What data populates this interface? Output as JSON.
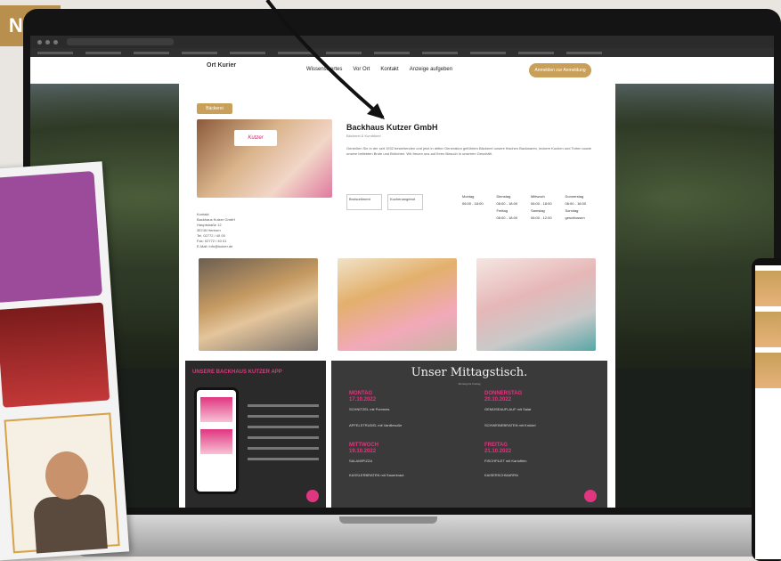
{
  "badge": {
    "text": "NAL"
  },
  "site": {
    "logo": "Ort Kurier",
    "nav": [
      "Wissenswertes",
      "Vor Ort",
      "Kontakt",
      "Anzeige aufgeben"
    ],
    "cta": "Anmelden zur Anmeldung"
  },
  "profile": {
    "tag": "Bäckerei",
    "logo_text": "Kutzer",
    "company": "Backhaus Kutzer GmbH",
    "subtitle": "Bäckerei & Konditorei",
    "description": "Genießen Sie in der seit 1932 bestehenden und jetzt in dritter Generation geführten Bäckerei unsere frischen Backwaren, leckere Kuchen und Torten sowie unsere beliebten Brote und Brötchen. Wir freuen uns auf Ihren Besuch in unserem Geschäft.",
    "info_boxes": [
      "Brotsortiment",
      "Kuchenangebot"
    ],
    "hours": [
      "Montag",
      "Dienstag",
      "Mittwoch",
      "Donnerstag",
      "06:00 - 18:00",
      "06:00 - 18:00",
      "06:00 - 18:00",
      "06:00 - 18:00",
      "",
      "Freitag",
      "Samstag",
      "Sonntag",
      "",
      "06:00 - 18:00",
      "06:00 - 12:00",
      "geschlossen"
    ],
    "contact": [
      "Kontakt",
      "Backhaus Kutzer GmbH",
      "Hauptstraße 12",
      "35745 Herborn",
      "Tel. 02772 / 40 00",
      "Fax: 02772 / 40 01",
      "E-Mail: info@kutzer.de"
    ]
  },
  "app_panel": {
    "title": "UNSERE BACKHAUS KUTZER APP"
  },
  "menu_panel": {
    "title": "Unser Mittagstisch.",
    "subtitle": "Montag bis Freitag",
    "days": [
      {
        "day": "MONTAG",
        "date": "17.10.2022",
        "dishes": [
          "SCHNITZEL mit Pommes",
          "APFELSTRUDEL mit Vanillesoße"
        ]
      },
      {
        "day": "DONNERSTAG",
        "date": "20.10.2022",
        "dishes": [
          "GEMÜSEAUFLAUF mit Salat",
          "SCHWEINEBRATEN mit Knödel"
        ]
      },
      {
        "day": "MITTWOCH",
        "date": "19.10.2022",
        "dishes": [
          "SALAMIPIZZA",
          "KASSLERBRATEN mit Sauerkraut"
        ]
      },
      {
        "day": "FREITAG",
        "date": "21.10.2022",
        "dishes": [
          "FISCHFILET mit Kartoffeln",
          "KAISERSCHMARRN"
        ]
      }
    ]
  }
}
